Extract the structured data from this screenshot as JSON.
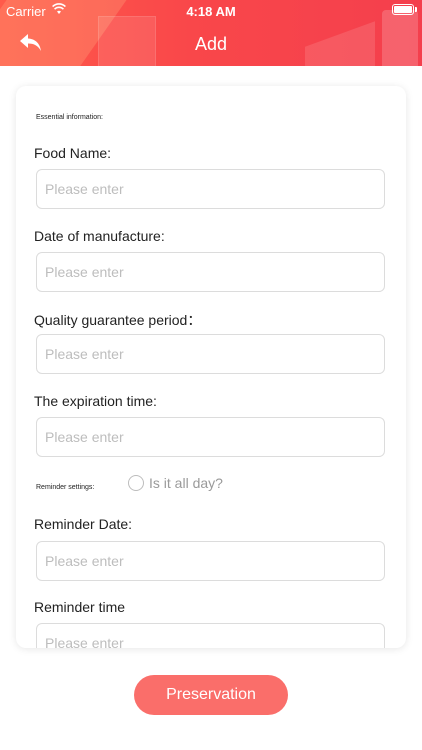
{
  "status_bar": {
    "carrier": "Carrier",
    "time": "4:18 AM"
  },
  "nav": {
    "title": "Add"
  },
  "form": {
    "essential_label": "Essential information:",
    "food_name_label": "Food Name:",
    "manufacture_label": "Date of manufacture:",
    "guarantee_label": "Quality guarantee period：",
    "expiration_label": "The expiration time:",
    "reminder_settings_label": "Reminder settings:",
    "all_day_label": "Is it all day?",
    "reminder_date_label": "Reminder Date:",
    "reminder_time_label": "Reminder time",
    "placeholder": "Please enter"
  },
  "actions": {
    "save_label": "Preservation"
  },
  "colors": {
    "header": "#f9474a",
    "button": "#fa6e6a"
  }
}
